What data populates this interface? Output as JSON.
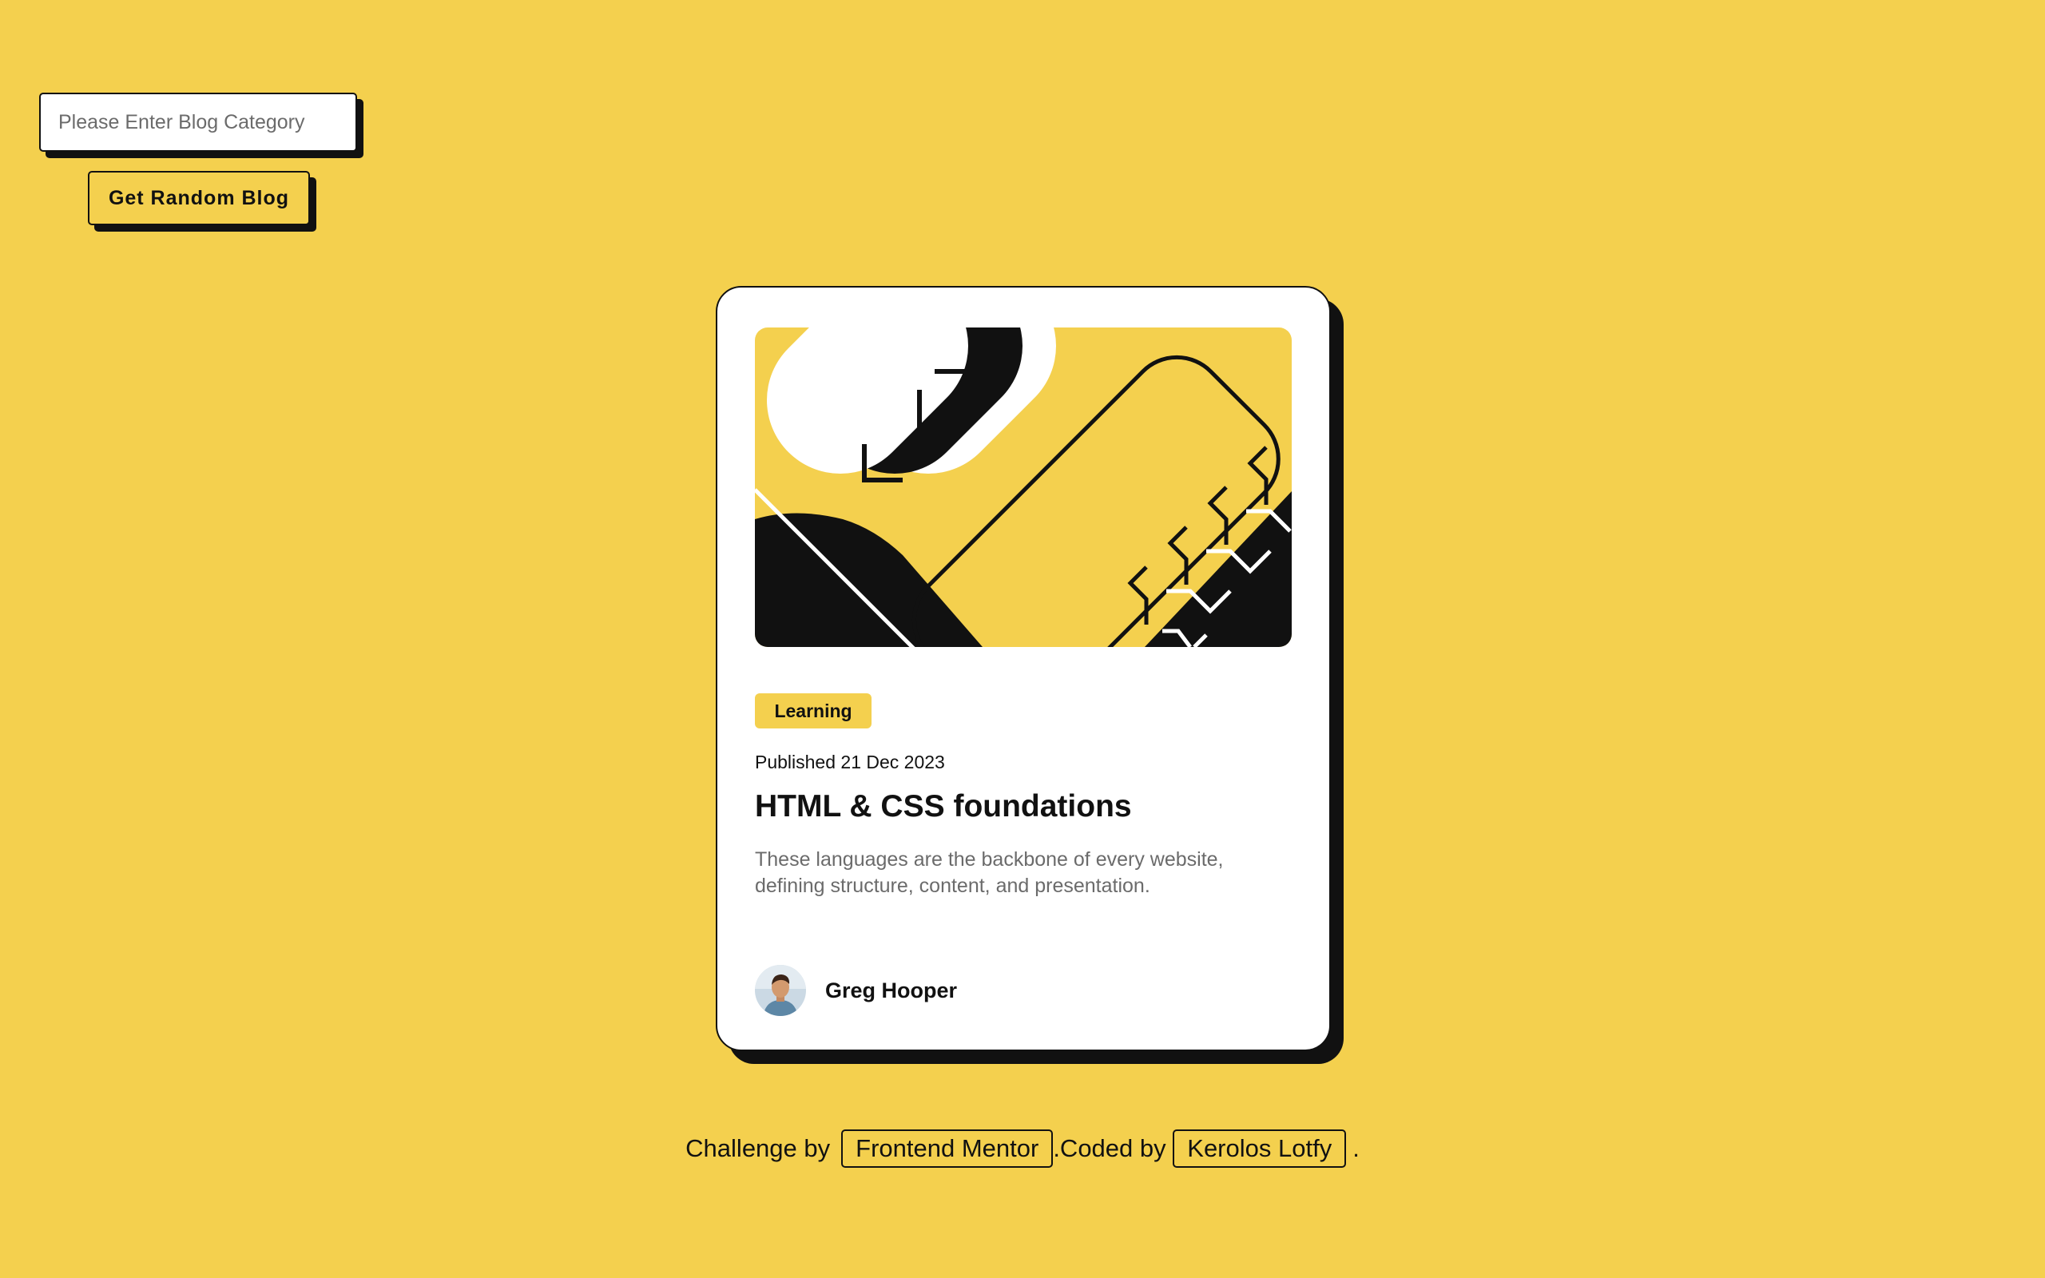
{
  "search": {
    "placeholder": "Please Enter Blog Category",
    "value": ""
  },
  "random_button": {
    "label": "Get Random Blog"
  },
  "card": {
    "badge": "Learning",
    "published": "Published 21 Dec 2023",
    "title": "HTML & CSS foundations",
    "description": "These languages are the backbone of every website, defining structure, content, and presentation.",
    "author_name": "Greg Hooper"
  },
  "attribution": {
    "prefix": "Challenge by",
    "mentor_link": "Frontend Mentor",
    "middle": ".Coded by",
    "author_link": "Kerolos Lotfy",
    "suffix": "."
  },
  "colors": {
    "background": "#F4D04E",
    "ink": "#111111",
    "card": "#FFFFFF",
    "muted_text": "#6B6B6B"
  },
  "icons": {
    "illustration": "blog-illustration",
    "avatar": "author-avatar"
  }
}
